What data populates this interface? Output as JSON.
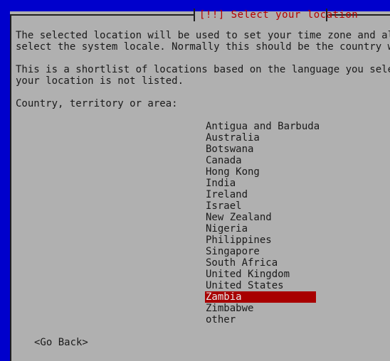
{
  "screen": {
    "backdrop_color": "#0000cc",
    "dialog_bg_color": "#b0b0b0",
    "frame_color": "#202020"
  },
  "dialog": {
    "title": "[!!] Select your location",
    "title_color": "#b40000",
    "paragraphs": [
      "The selected location will be used to set your time zone and also\nselect the system locale. Normally this should be the country wher",
      "This is a shortlist of locations based on the language you selecte\nyour location is not listed."
    ],
    "prompt_label": "Country, territory or area:"
  },
  "country_list": {
    "selected_index": 15,
    "selected_bg_color": "#a80000",
    "selected_text_color": "#e8e8e8",
    "items": [
      "Antigua and Barbuda",
      "Australia",
      "Botswana",
      "Canada",
      "Hong Kong",
      "India",
      "Ireland",
      "Israel",
      "New Zealand",
      "Nigeria",
      "Philippines",
      "Singapore",
      "South Africa",
      "United Kingdom",
      "United States",
      "Zambia",
      "Zimbabwe",
      "other"
    ]
  },
  "buttons": {
    "go_back": "<Go Back>"
  }
}
